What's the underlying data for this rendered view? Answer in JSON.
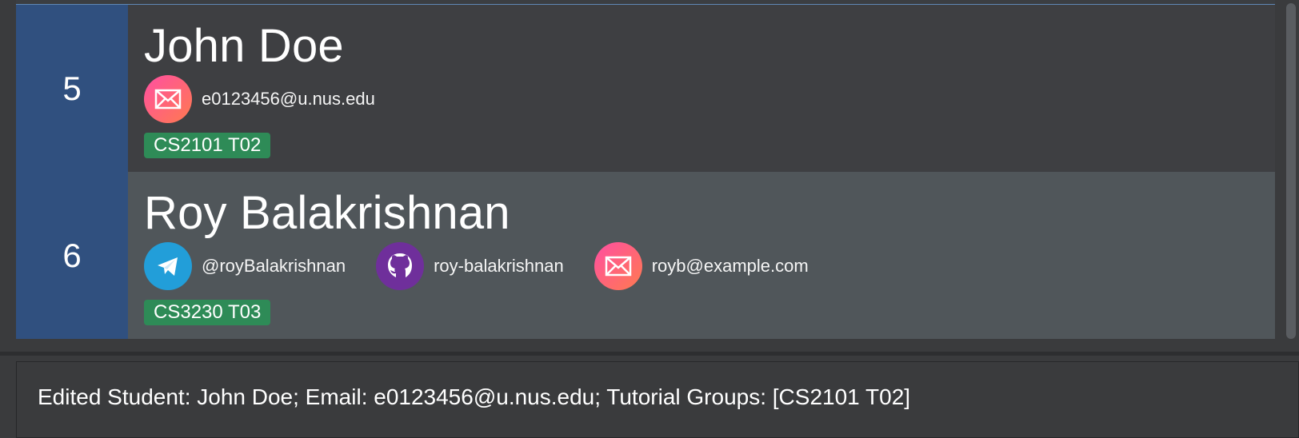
{
  "students": [
    {
      "index": "5",
      "name": "John Doe",
      "contacts": [
        {
          "icon": "email-icon",
          "text": "e0123456@u.nus.edu"
        }
      ],
      "tag": "CS2101 T02"
    },
    {
      "index": "6",
      "name": "Roy Balakrishnan",
      "contacts": [
        {
          "icon": "telegram-icon",
          "text": "@royBalakrishnan"
        },
        {
          "icon": "github-icon",
          "text": "roy-balakrishnan"
        },
        {
          "icon": "email-icon",
          "text": "royb@example.com"
        }
      ],
      "tag": "CS3230 T03"
    }
  ],
  "result": {
    "message": "Edited Student: John Doe; Email: e0123456@u.nus.edu; Tutorial Groups: [CS2101 T02]"
  },
  "colors": {
    "index_background": "#30507f",
    "selected_card": "#50565a",
    "tag_green": "#2e8b57",
    "app_background": "#3a3b3d"
  }
}
